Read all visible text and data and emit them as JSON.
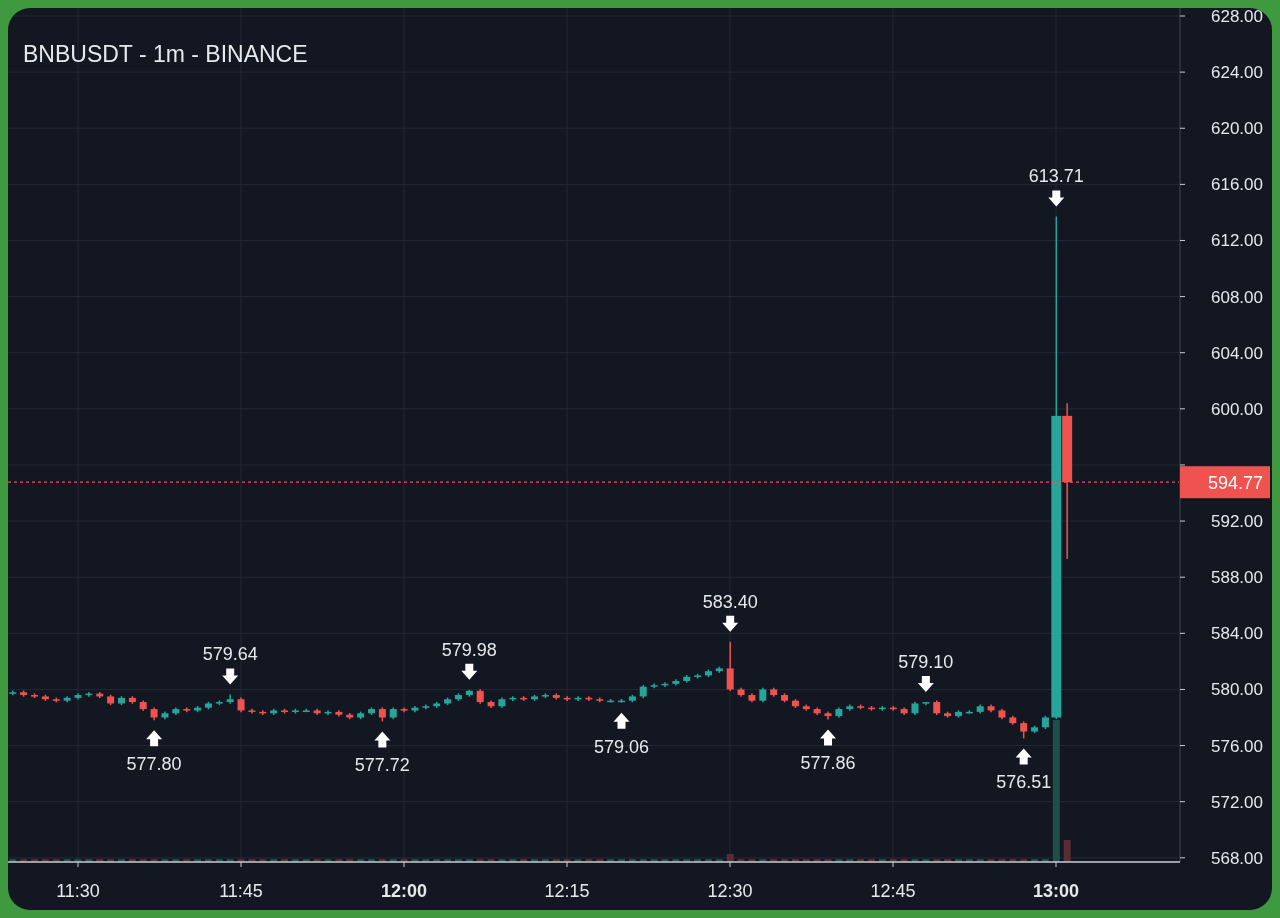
{
  "chart": {
    "title": "BNBUSDT - 1m - BINANCE",
    "price_axis": [
      "628.00",
      "624.00",
      "620.00",
      "616.00",
      "612.00",
      "608.00",
      "604.00",
      "600.00",
      "592.00",
      "588.00",
      "584.00",
      "580.00",
      "576.00",
      "572.00",
      "568.00"
    ],
    "time_axis": [
      {
        "label": "11:30",
        "major": false
      },
      {
        "label": "11:45",
        "major": false
      },
      {
        "label": "12:00",
        "major": true
      },
      {
        "label": "12:15",
        "major": false
      },
      {
        "label": "12:30",
        "major": false
      },
      {
        "label": "12:45",
        "major": false
      },
      {
        "label": "13:00",
        "major": true
      }
    ],
    "markers": [
      {
        "kind": "low",
        "label": "577.80"
      },
      {
        "kind": "high",
        "label": "579.64"
      },
      {
        "kind": "low",
        "label": "577.72"
      },
      {
        "kind": "high",
        "label": "579.98"
      },
      {
        "kind": "low",
        "label": "579.06"
      },
      {
        "kind": "high",
        "label": "583.40"
      },
      {
        "kind": "low",
        "label": "577.86"
      },
      {
        "kind": "high",
        "label": "579.10"
      },
      {
        "kind": "low",
        "label": "576.51"
      },
      {
        "kind": "high",
        "label": "613.71"
      }
    ],
    "last_price": "594.77"
  }
}
